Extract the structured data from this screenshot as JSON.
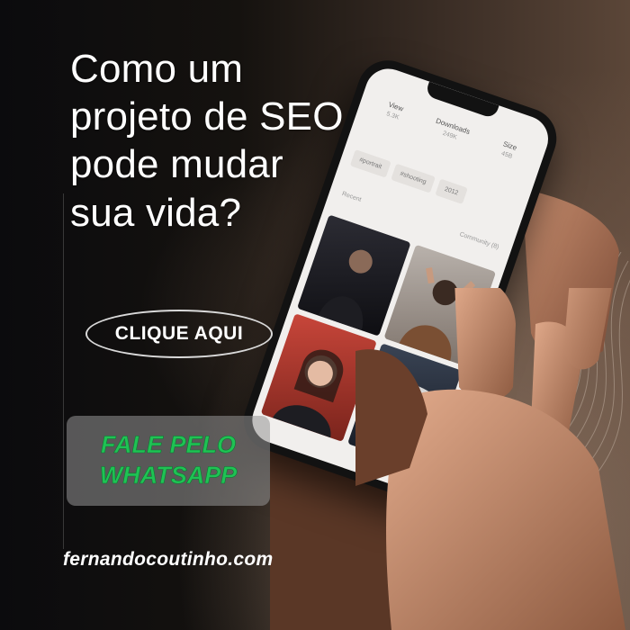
{
  "headline": {
    "lines": [
      "Como um",
      "projeto de SEO",
      "pode mudar",
      "sua vida?"
    ]
  },
  "cta": {
    "label": "CLIQUE AQUI"
  },
  "whatsapp": {
    "lines": [
      "FALE PELO",
      "WHATSAPP"
    ],
    "color": "#1fc254"
  },
  "site": {
    "url": "fernandocoutinho.com"
  },
  "phone_screen": {
    "stats": [
      {
        "label": "View",
        "value": "5.3K"
      },
      {
        "label": "Downloads",
        "value": "249K"
      },
      {
        "label": "Size",
        "value": "45B"
      }
    ],
    "tags": [
      "#portrait",
      "#shooting",
      "2012"
    ],
    "sort_label": "Recent",
    "filter_label": "Community (8)",
    "photos": [
      "photo-man-dark",
      "photo-man-hands-head",
      "photo-woman-smiling",
      "photo-person-hat"
    ]
  },
  "colors": {
    "background": "#0d0d0f",
    "accent_green": "#1fc254",
    "text": "#ffffff"
  }
}
